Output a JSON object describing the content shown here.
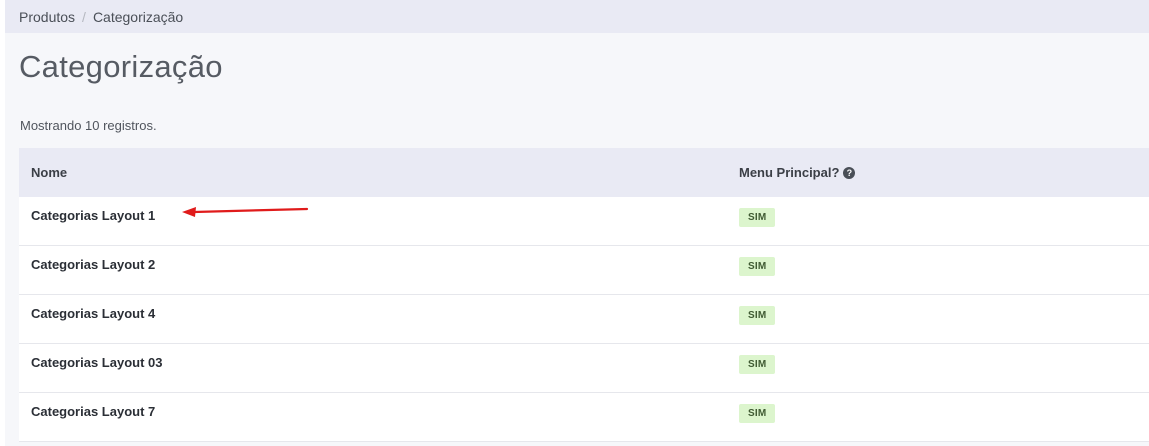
{
  "breadcrumb": {
    "items": [
      "Produtos",
      "Categorização"
    ],
    "separator": "/"
  },
  "page": {
    "title": "Categorização",
    "record_count": "Mostrando 10 registros."
  },
  "table": {
    "columns": [
      "Nome",
      "Menu Principal?"
    ],
    "help_icon_glyph": "?",
    "rows": [
      {
        "name": "Categorias Layout 1",
        "menu_principal": "SIM"
      },
      {
        "name": "Categorias Layout 2",
        "menu_principal": "SIM"
      },
      {
        "name": "Categorias Layout 4",
        "menu_principal": "SIM"
      },
      {
        "name": "Categorias Layout 03",
        "menu_principal": "SIM"
      },
      {
        "name": "Categorias Layout 7",
        "menu_principal": "SIM"
      }
    ]
  },
  "annotation": {
    "icon": "red-arrow-icon",
    "color": "#e01b1b"
  },
  "colors": {
    "header_bg": "#e9eaf4",
    "badge_bg": "#dcf5cd"
  }
}
